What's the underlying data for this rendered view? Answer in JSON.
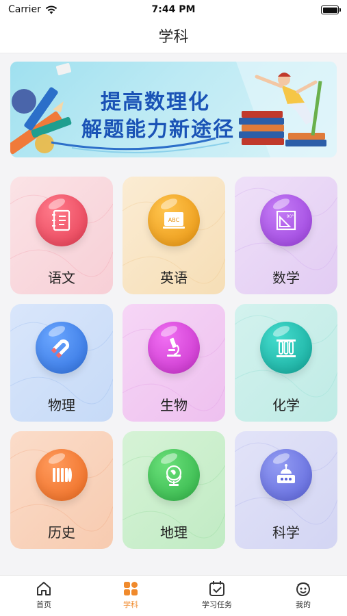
{
  "status": {
    "carrier": "Carrier",
    "time": "7:44 PM"
  },
  "nav": {
    "title": "学科"
  },
  "banner": {
    "line1": "提高数理化",
    "line2": "解题能力新途径"
  },
  "subjects": [
    {
      "label": "语文",
      "icon": "notebook-icon",
      "color": "#e84a5f"
    },
    {
      "label": "英语",
      "icon": "abc-board-icon",
      "color": "#f0a21b"
    },
    {
      "label": "数学",
      "icon": "protractor-icon",
      "color": "#a451e0"
    },
    {
      "label": "物理",
      "icon": "magnet-icon",
      "color": "#3a7fe8"
    },
    {
      "label": "生物",
      "icon": "microscope-icon",
      "color": "#d642d8"
    },
    {
      "label": "化学",
      "icon": "test-tubes-icon",
      "color": "#1cbdb0"
    },
    {
      "label": "历史",
      "icon": "bamboo-scroll-icon",
      "color": "#f27a2e"
    },
    {
      "label": "地理",
      "icon": "globe-icon",
      "color": "#3fc75a"
    },
    {
      "label": "科学",
      "icon": "robot-icon",
      "color": "#6f79e6"
    }
  ],
  "tabs": [
    {
      "label": "首页",
      "icon": "home-icon"
    },
    {
      "label": "学科",
      "icon": "grid-icon"
    },
    {
      "label": "学习任务",
      "icon": "calendar-check-icon"
    },
    {
      "label": "我的",
      "icon": "face-icon"
    }
  ],
  "active_tab": "学科",
  "accent_color": "#f08a2c"
}
